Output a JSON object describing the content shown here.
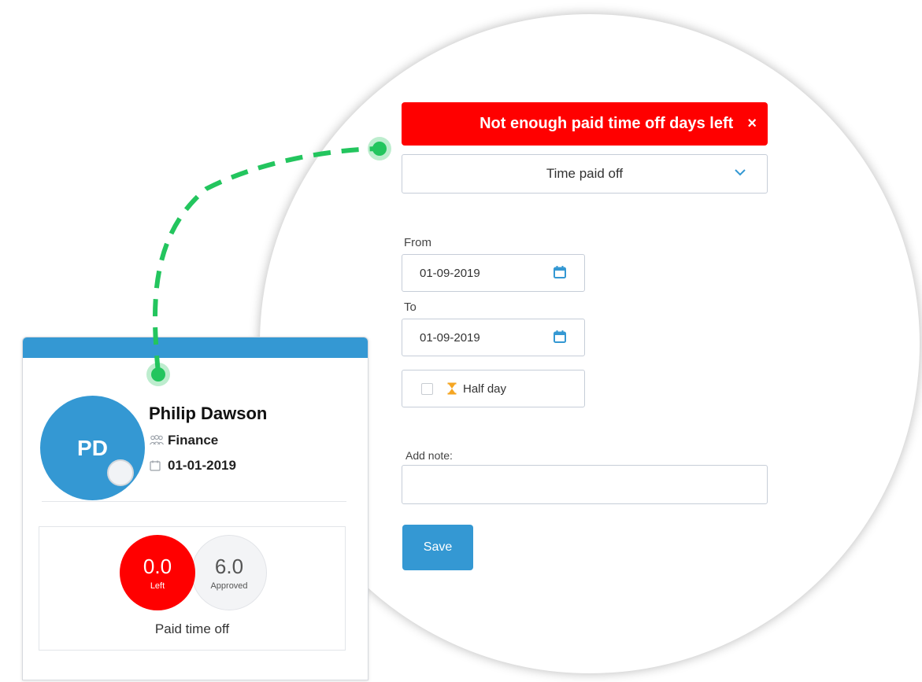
{
  "colors": {
    "error_red": "#ff0000",
    "accent_blue": "#3498d3",
    "connector_green": "#23c55e"
  },
  "request_form": {
    "error_message": "Not enough paid time off days left",
    "error_close": "×",
    "type_select_value": "Time paid off",
    "from_label": "From",
    "from_value": "01-09-2019",
    "to_label": "To",
    "to_value": "01-09-2019",
    "half_day_label": "Half day",
    "half_day_checked": false,
    "note_label": "Add note:",
    "note_value": "",
    "save_label": "Save"
  },
  "employee_card": {
    "initials": "PD",
    "name": "Philip Dawson",
    "department": "Finance",
    "start_date": "01-01-2019",
    "pto": {
      "left_value": "0.0",
      "left_label": "Left",
      "approved_value": "6.0",
      "approved_label": "Approved",
      "title": "Paid time off"
    }
  }
}
